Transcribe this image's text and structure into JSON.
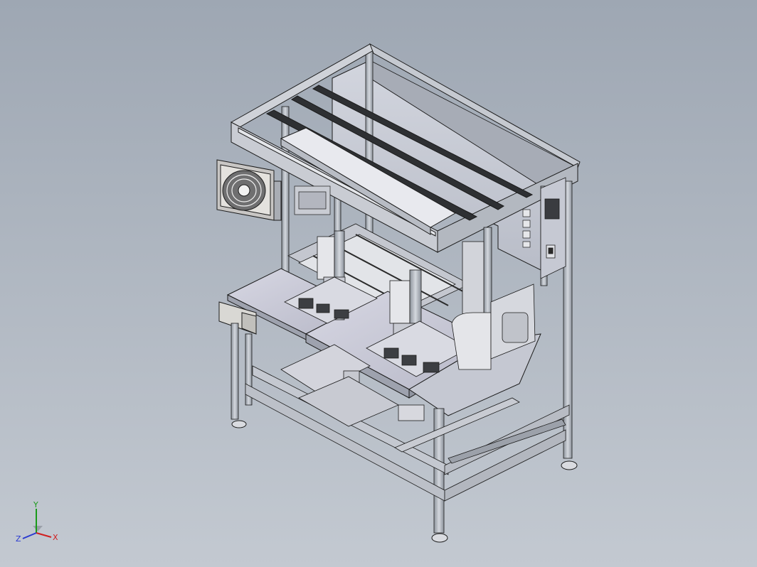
{
  "view": {
    "background_top": "#9ea7b3",
    "background_bottom": "#c3c9d1",
    "frame_color": "#b9bec6",
    "panel_color": "#c9ccd6",
    "edge_color": "#1c1c1c"
  },
  "triad": {
    "y_label": "Y",
    "z_label": "Z",
    "x_label": "X",
    "y_color": "#1a9a1a",
    "z_color": "#2a3ad0",
    "x_color": "#d02020"
  }
}
